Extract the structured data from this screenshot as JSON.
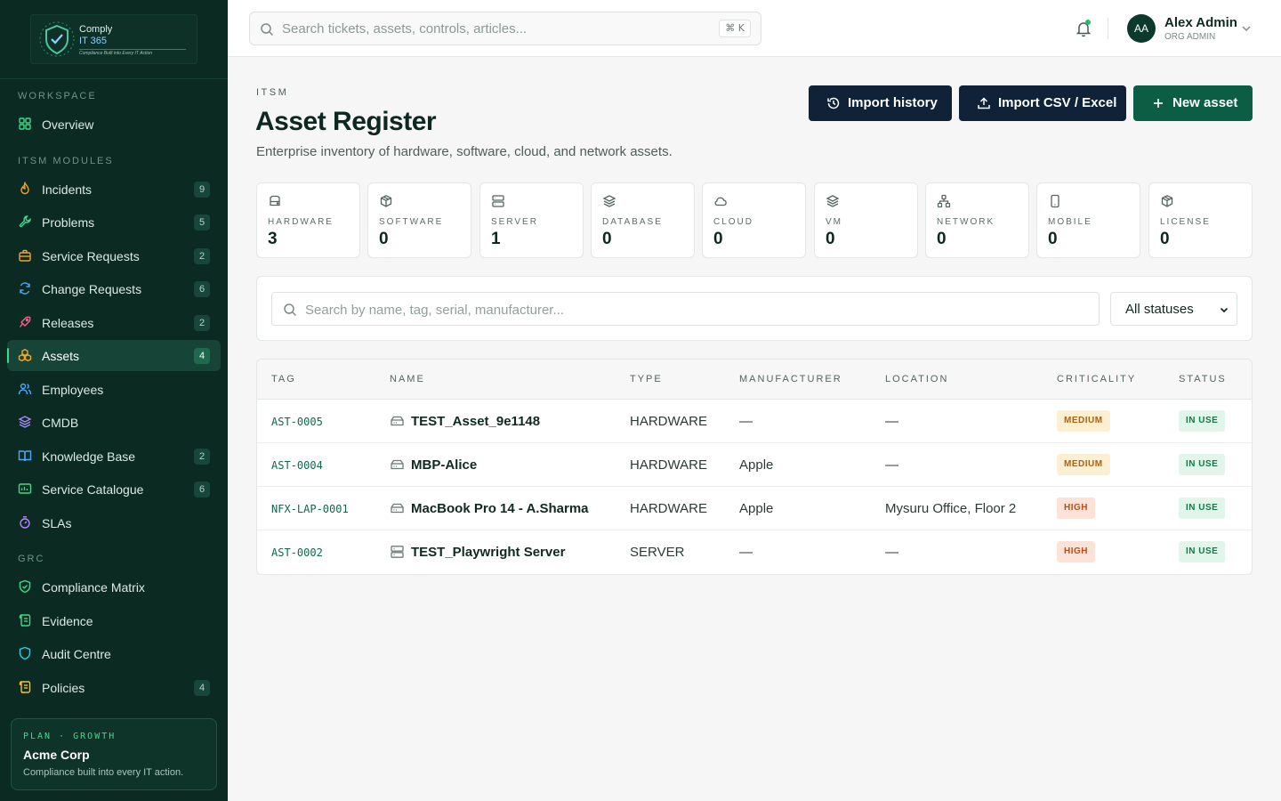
{
  "brand": {
    "name_line1": "Comply",
    "name_line2": "IT 365",
    "tagline": "Compliance Built into Every IT Action"
  },
  "sidebar": {
    "sections": [
      "WORKSPACE",
      "ITSM MODULES",
      "GRC"
    ],
    "items": [
      {
        "label": "Overview",
        "icon": "grid-icon",
        "badge": ""
      },
      {
        "label": "Incidents",
        "icon": "flame-icon",
        "badge": "9"
      },
      {
        "label": "Problems",
        "icon": "wrench-icon",
        "badge": "5"
      },
      {
        "label": "Service Requests",
        "icon": "briefcase-icon",
        "badge": "2"
      },
      {
        "label": "Change Requests",
        "icon": "refresh-icon",
        "badge": "6"
      },
      {
        "label": "Releases",
        "icon": "rocket-icon",
        "badge": "2"
      },
      {
        "label": "Assets",
        "icon": "boxes-icon",
        "badge": "4"
      },
      {
        "label": "Employees",
        "icon": "users-icon",
        "badge": ""
      },
      {
        "label": "CMDB",
        "icon": "layers-icon",
        "badge": ""
      },
      {
        "label": "Knowledge Base",
        "icon": "book-icon",
        "badge": "2"
      },
      {
        "label": "Service Catalogue",
        "icon": "catalogue-icon",
        "badge": "6"
      },
      {
        "label": "SLAs",
        "icon": "timer-icon",
        "badge": ""
      },
      {
        "label": "Compliance Matrix",
        "icon": "shield-check-icon",
        "badge": ""
      },
      {
        "label": "Evidence",
        "icon": "scroll-icon",
        "badge": ""
      },
      {
        "label": "Audit Centre",
        "icon": "shield-icon",
        "badge": ""
      },
      {
        "label": "Policies",
        "icon": "scroll-icon",
        "badge": "4"
      }
    ],
    "active": "Assets",
    "plan": {
      "label": "PLAN · GROWTH",
      "org": "Acme Corp",
      "tagline": "Compliance built into every IT action."
    }
  },
  "topbar": {
    "search_placeholder": "Search tickets, assets, controls, articles...",
    "shortcut": "⌘ K",
    "user": {
      "initials": "AA",
      "name": "Alex Admin",
      "role": "ORG ADMIN"
    }
  },
  "header": {
    "eyebrow": "ITSM",
    "title": "Asset Register",
    "subtitle": "Enterprise inventory of hardware, software, cloud, and network assets.",
    "buttons": {
      "import_history": "Import history",
      "import_csv": "Import CSV / Excel",
      "new_asset": "New asset"
    }
  },
  "stats": [
    {
      "label": "HARDWARE",
      "value": "3",
      "icon": "hard-drive-icon"
    },
    {
      "label": "SOFTWARE",
      "value": "0",
      "icon": "package-icon"
    },
    {
      "label": "SERVER",
      "value": "1",
      "icon": "server-icon"
    },
    {
      "label": "DATABASE",
      "value": "0",
      "icon": "layers-icon"
    },
    {
      "label": "CLOUD",
      "value": "0",
      "icon": "cloud-icon"
    },
    {
      "label": "VM",
      "value": "0",
      "icon": "layers-icon"
    },
    {
      "label": "NETWORK",
      "value": "0",
      "icon": "network-icon"
    },
    {
      "label": "MOBILE",
      "value": "0",
      "icon": "smartphone-icon"
    },
    {
      "label": "LICENSE",
      "value": "0",
      "icon": "package-icon"
    }
  ],
  "filters": {
    "search_placeholder": "Search by name, tag, serial, manufacturer...",
    "status_selected": "All statuses"
  },
  "table": {
    "columns": [
      "TAG",
      "NAME",
      "TYPE",
      "MANUFACTURER",
      "LOCATION",
      "CRITICALITY",
      "STATUS"
    ],
    "rows": [
      {
        "tag": "AST-0005",
        "name": "TEST_Asset_9e1148",
        "type": "HARDWARE",
        "manufacturer": "—",
        "location": "—",
        "criticality": "MEDIUM",
        "status": "IN USE",
        "icon": "hard-drive-icon"
      },
      {
        "tag": "AST-0004",
        "name": "MBP-Alice",
        "type": "HARDWARE",
        "manufacturer": "Apple",
        "location": "—",
        "criticality": "MEDIUM",
        "status": "IN USE",
        "icon": "hard-drive-icon"
      },
      {
        "tag": "NFX-LAP-0001",
        "name": "MacBook Pro 14 - A.Sharma",
        "type": "HARDWARE",
        "manufacturer": "Apple",
        "location": "Mysuru Office, Floor 2",
        "criticality": "HIGH",
        "status": "IN USE",
        "icon": "hard-drive-icon"
      },
      {
        "tag": "AST-0002",
        "name": "TEST_Playwright Server",
        "type": "SERVER",
        "manufacturer": "—",
        "location": "—",
        "criticality": "HIGH",
        "status": "IN USE",
        "icon": "server-icon"
      }
    ]
  },
  "colors": {
    "sidebar_bg": "#0b2a22",
    "accent_green": "#0b5d43",
    "dark_button": "#0f2237",
    "medium_pill": "#fdf0d2",
    "high_pill": "#fde3d7",
    "status_pill": "#e2f5ea"
  }
}
